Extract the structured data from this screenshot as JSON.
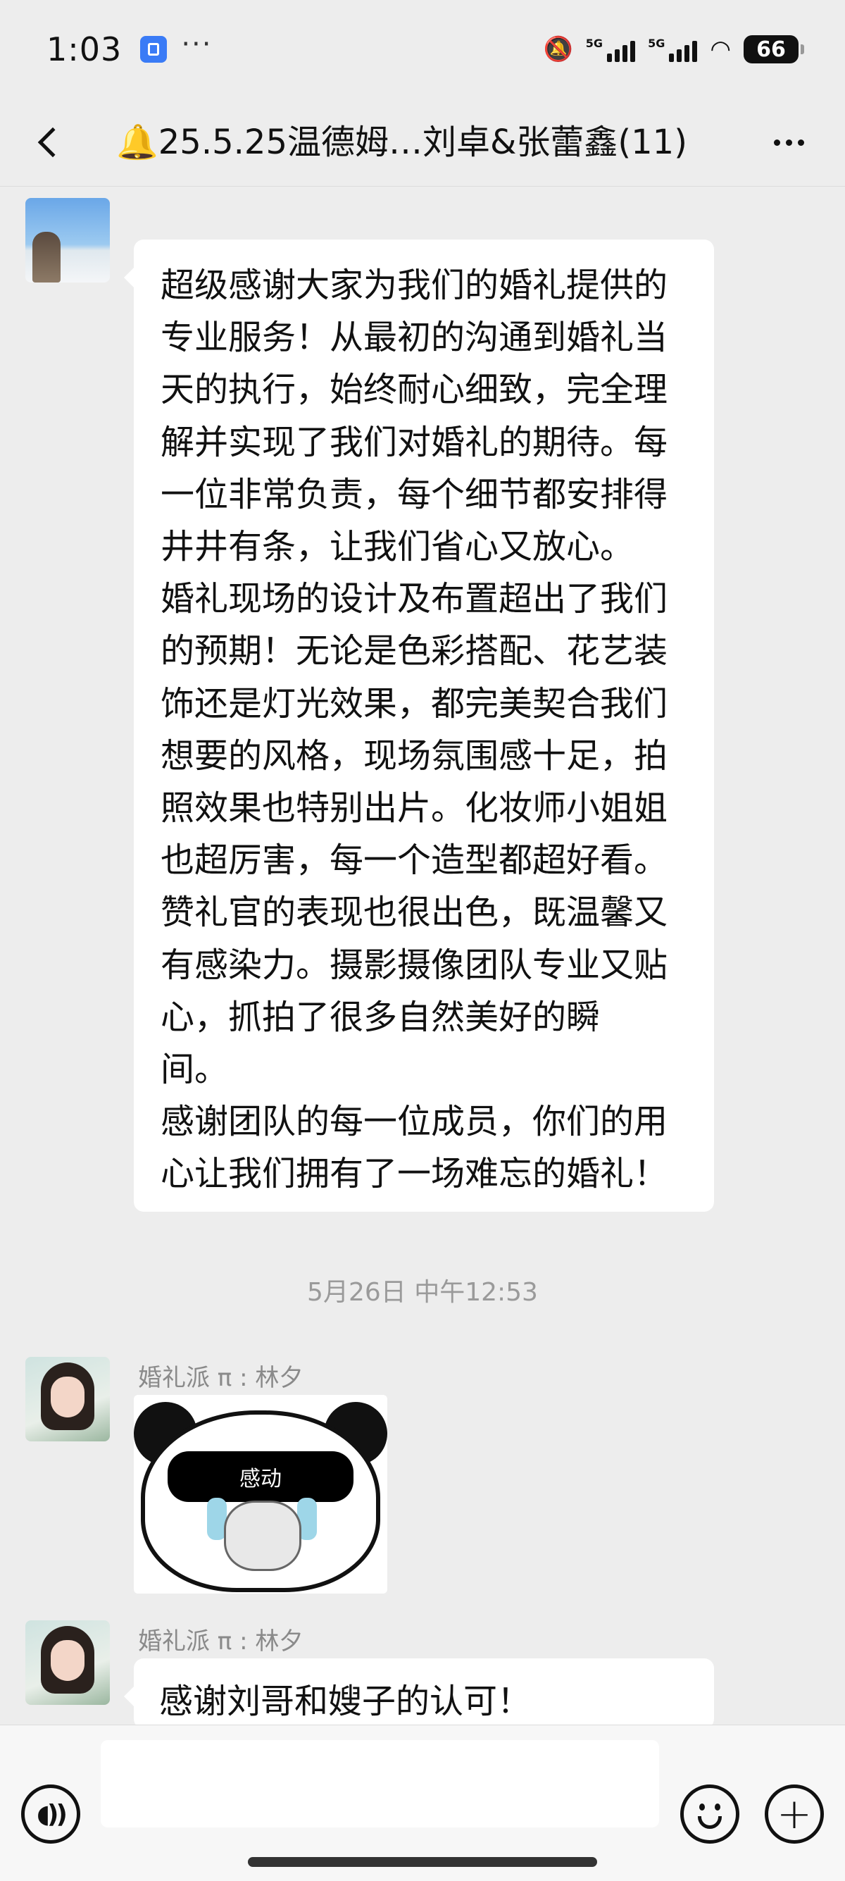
{
  "status_bar": {
    "time": "1:03",
    "more": "···",
    "network_1": "5G",
    "network_2": "5G",
    "battery": "66",
    "icons": [
      "app-notification-icon",
      "mute-icon",
      "signal-icon",
      "wifi-icon",
      "battery-icon"
    ]
  },
  "nav": {
    "title": "🔔25.5.25温德姆…刘卓&张蕾鑫(11)",
    "icons": [
      "back-icon",
      "more-icon"
    ]
  },
  "messages": [
    {
      "sender": "",
      "avatar": "avatar-snow",
      "text": "超级感谢大家为我们的婚礼提供的专业服务！从最初的沟通到婚礼当天的执行，始终耐心细致，完全理解并实现了我们对婚礼的期待。每一位非常负责，每个细节都安排得井井有条，让我们省心又放心。\n婚礼现场的设计及布置超出了我们的预期！无论是色彩搭配、花艺装饰还是灯光效果，都完美契合我们想要的风格，现场氛围感十足，拍照效果也特别出片。化妆师小姐姐也超厉害，每一个造型都超好看。赞礼官的表现也很出色，既温馨又有感染力。摄影摄像团队专业又贴心，抓拍了很多自然美好的瞬\n间。\n感谢团队的每一位成员，你们的用心让我们拥有了一场难忘的婚礼！"
    },
    {
      "sender": "婚礼派 π : 林夕",
      "avatar": "avatar-girl",
      "sticker_text": "感动"
    },
    {
      "sender": "婚礼派 π : 林夕",
      "avatar": "avatar-girl",
      "text": "感谢刘哥和嫂子的认可！"
    }
  ],
  "timestamp": "5月26日 中午12:53",
  "input": {
    "value": "",
    "icons": [
      "voice-icon",
      "emoji-icon",
      "plus-icon"
    ]
  },
  "colors": {
    "background": "#ededed",
    "bubble": "#ffffff",
    "meta_text": "#9a9a9a"
  }
}
